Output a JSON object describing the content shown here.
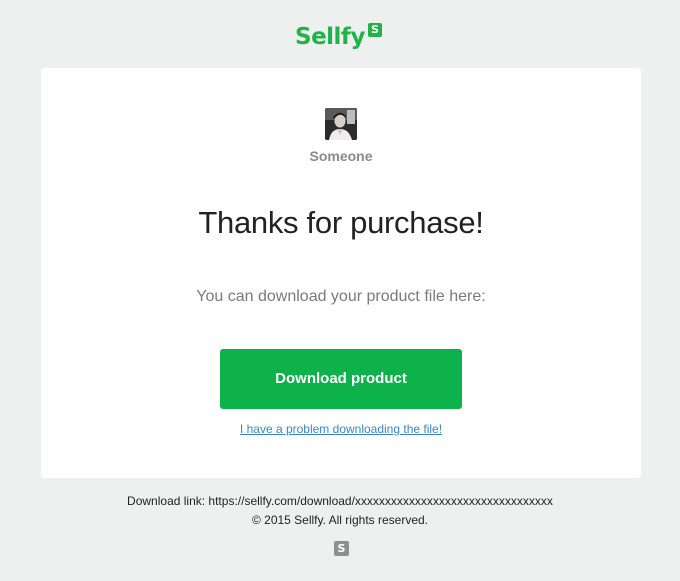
{
  "brand": {
    "name": "Sellfy",
    "badge_letter": "S",
    "color": "#21b34a"
  },
  "seller": {
    "name": "Someone",
    "avatar_icon": "user-photo"
  },
  "main": {
    "title": "Thanks for purchase!",
    "subtitle": "You can download your product file here:",
    "download_button_label": "Download product",
    "download_button_color": "#0db24b",
    "problem_link_label": "I have a problem downloading the file!"
  },
  "footer": {
    "download_link_text": "Download link: https://sellfy.com/download/xxxxxxxxxxxxxxxxxxxxxxxxxxxxxxxxx",
    "copyright": "© 2015 Sellfy. All rights reserved.",
    "badge_letter": "S"
  }
}
